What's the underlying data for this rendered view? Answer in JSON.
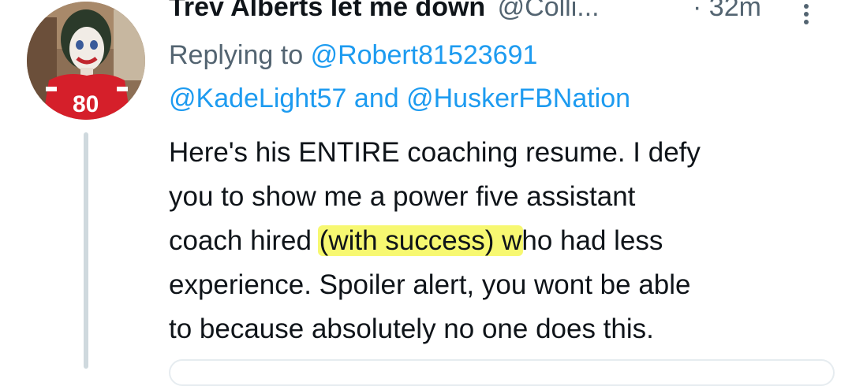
{
  "tweet": {
    "author_name": "Trev Alberts let me down",
    "author_handle": "@Colli...",
    "separator": "·",
    "time": "32m",
    "more_icon": "more-vertical-icon",
    "reply_prefix": "Replying to",
    "reply_mentions": [
      "@Robert81523691",
      "@KadeLight57",
      "@HuskerFBNation"
    ],
    "reply_and": "and",
    "body_lines": [
      "Here's his ENTIRE coaching resume. I defy",
      "you to show me a power five assistant",
      "coach hired (with success) who had less",
      "experience. Spoiler alert, you wont be able",
      "to because absolutely no one does this."
    ],
    "body_line3_before": "coach hired ",
    "body_line3_highlight": "(with success) w",
    "body_line3_after": "ho had less",
    "highlight_color": "#f4f642",
    "mention_color": "#1d9bf0",
    "avatar_jersey_number": "80"
  }
}
